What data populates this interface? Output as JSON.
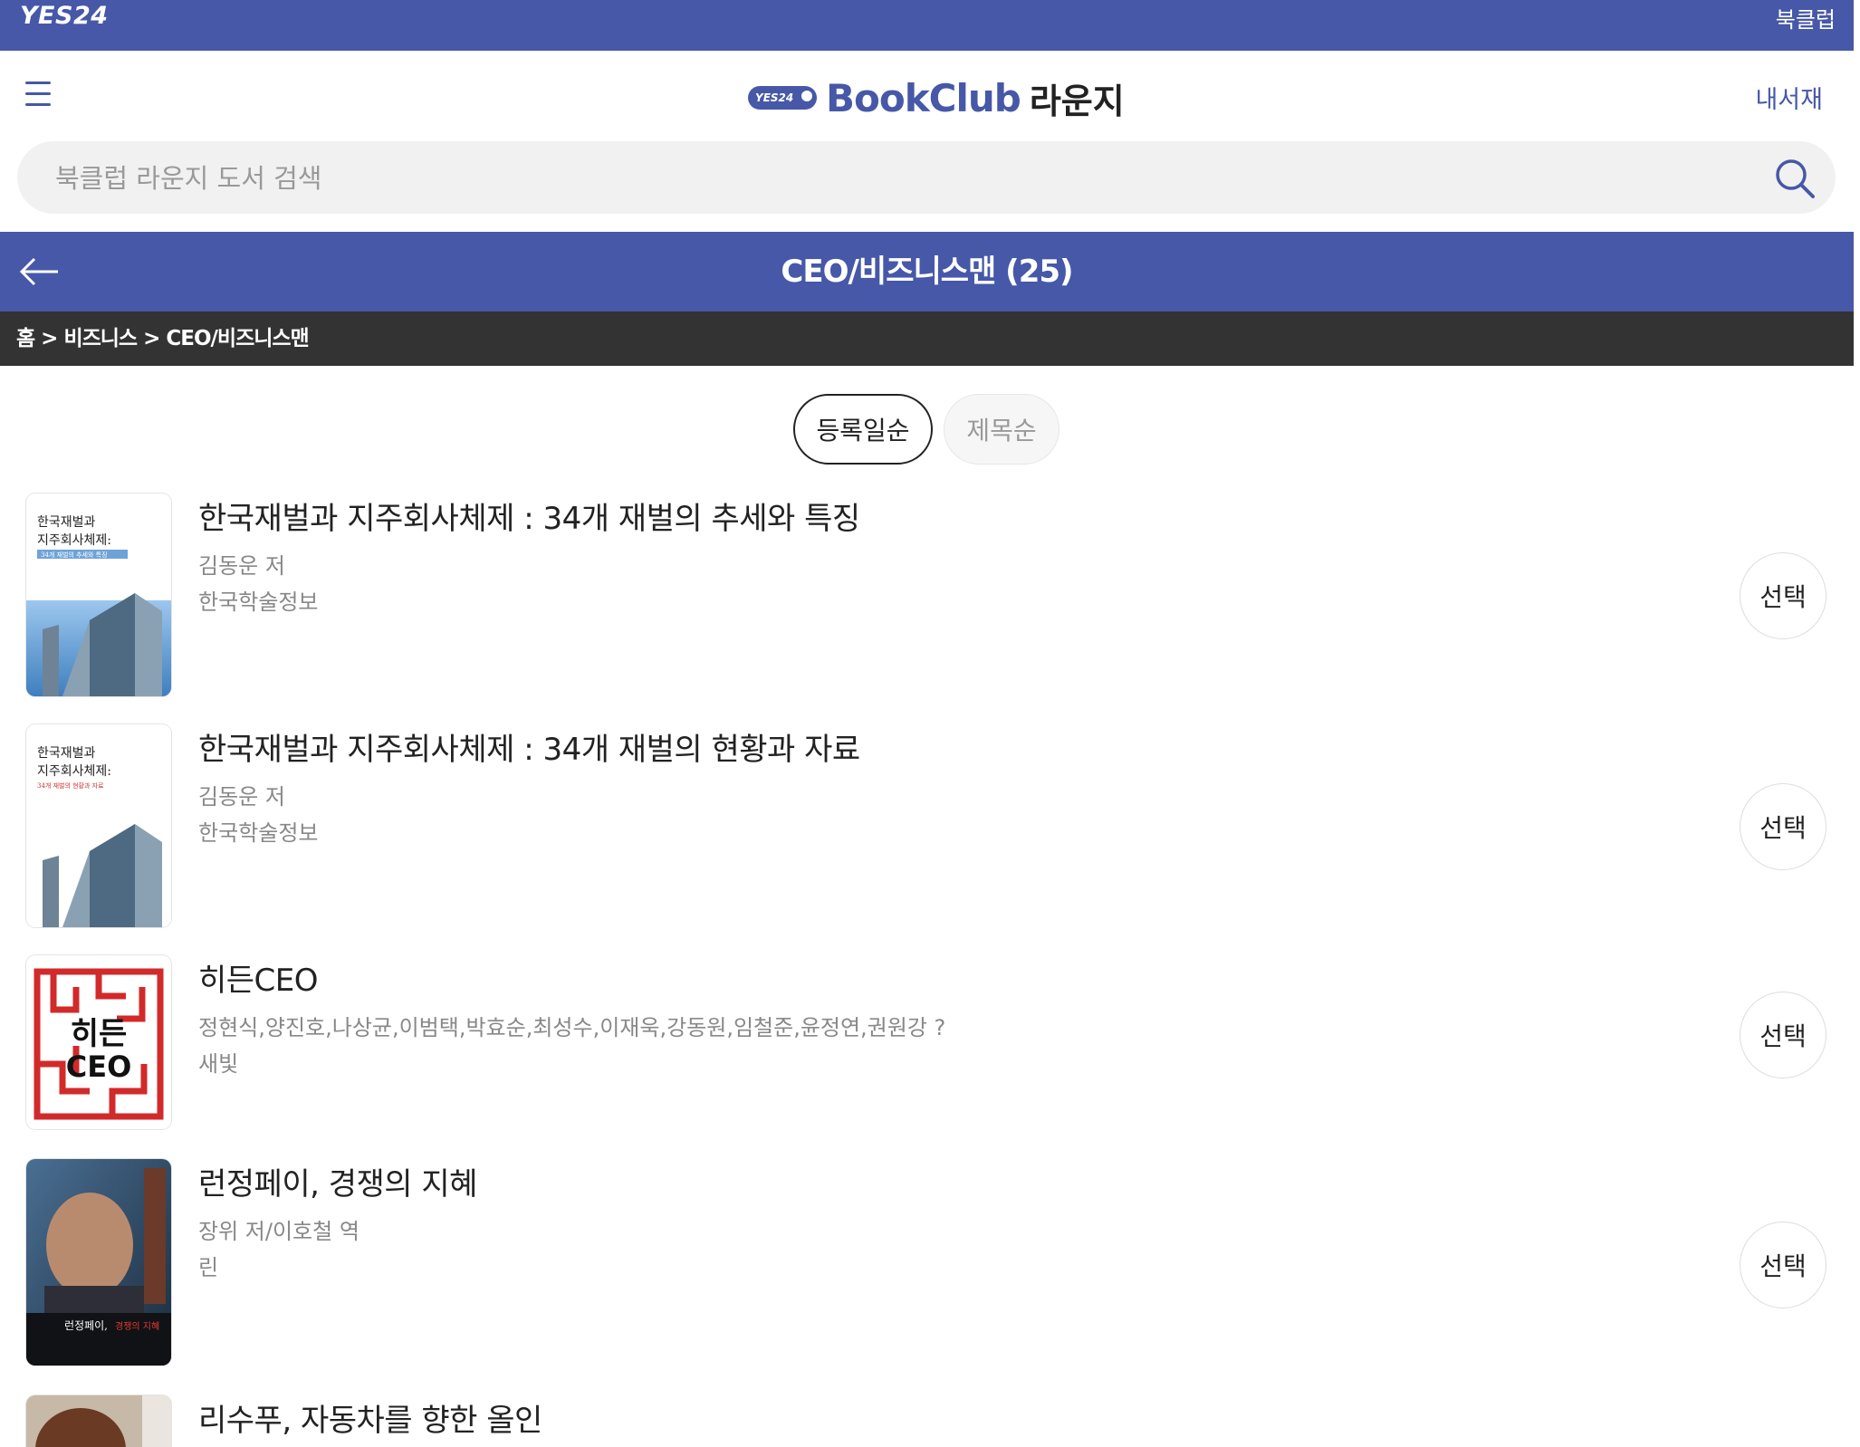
{
  "topbar": {
    "brand": "YES24",
    "link": "북클럽"
  },
  "header": {
    "logo_badge": "YES24",
    "logo_text": "BookClub",
    "logo_suffix": "라운지",
    "my_library": "내서재"
  },
  "search": {
    "placeholder": "북클럽 라운지 도서 검색"
  },
  "category": {
    "title": "CEO/비즈니스맨 (25)",
    "breadcrumb": "홈 > 비즈니스 > CEO/비즈니스맨"
  },
  "sort": {
    "active": "등록일순",
    "inactive": "제목순"
  },
  "books": [
    {
      "title": "한국재벌과 지주회사체제 : 34개 재벌의 추세와 특징",
      "author": "김동운 저",
      "publisher": "한국학술정보",
      "select": "선택",
      "cover_lines": [
        "한국재벌과",
        "지주회사체제:",
        "34개 재벌의 추세와 특징"
      ]
    },
    {
      "title": "한국재벌과 지주회사체제 : 34개 재벌의 현황과 자료",
      "author": "김동운 저",
      "publisher": "한국학술정보",
      "select": "선택",
      "cover_lines": [
        "한국재벌과",
        "지주회사체제:",
        "34개 재벌의 현황과 자료"
      ]
    },
    {
      "title": "히든CEO",
      "author": "정현식,양진호,나상균,이범택,박효순,최성수,이재욱,강동원,임철준,윤정연,권원강 ?",
      "publisher": "새빛",
      "select": "선택",
      "cover_lines": [
        "히든",
        "CEO"
      ]
    },
    {
      "title": "런정페이, 경쟁의 지혜",
      "author": "장위 저/이호철 역",
      "publisher": "린",
      "select": "선택",
      "cover_lines": [
        "런정페이,",
        "경쟁의 지혜"
      ]
    },
    {
      "title": "리수푸, 자동차를 향한 올인",
      "author": "",
      "publisher": "",
      "select": ""
    }
  ],
  "colors": {
    "brand": "#4658a7",
    "crumb_bg": "#333333"
  }
}
